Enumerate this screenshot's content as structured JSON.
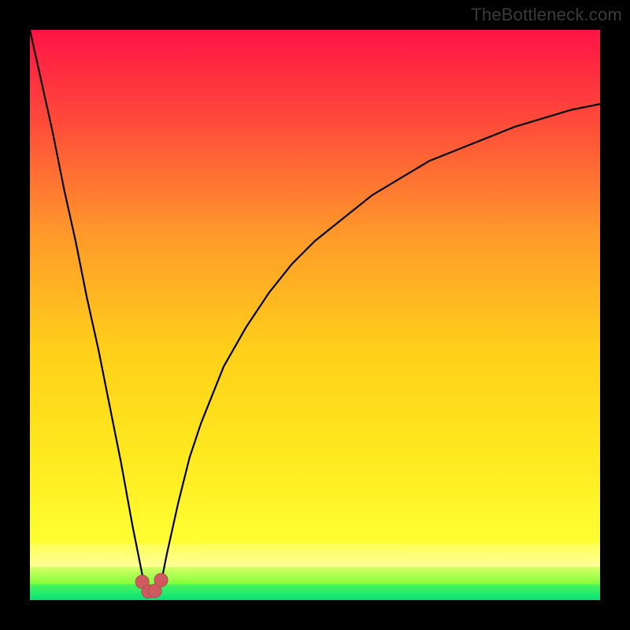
{
  "watermark": "TheBottleneck.com",
  "colors": {
    "frame": "#000000",
    "top": "#ff1a46",
    "upper_mid": "#ff7a26",
    "mid": "#ffd400",
    "low_band": "#ffff6a",
    "green_top": "#7dff3c",
    "green_bottom": "#05e27a",
    "curve": "#000000",
    "marker_fill": "#cf5b60",
    "marker_stroke": "#b24a4f"
  },
  "chart_data": {
    "type": "line",
    "title": "",
    "xlabel": "",
    "ylabel": "",
    "xlim": [
      0,
      100
    ],
    "ylim": [
      0,
      100
    ],
    "x": [
      0,
      2,
      4,
      6,
      8,
      10,
      12,
      14,
      16,
      18,
      19,
      20,
      21,
      22,
      23,
      24,
      26,
      28,
      30,
      34,
      38,
      42,
      46,
      50,
      55,
      60,
      65,
      70,
      75,
      80,
      85,
      90,
      95,
      100
    ],
    "values": [
      100,
      91,
      82,
      72,
      63,
      53,
      44,
      34,
      24,
      13,
      8,
      3,
      1,
      1,
      3,
      8,
      17,
      25,
      31,
      41,
      48,
      54,
      59,
      63,
      67,
      71,
      74,
      77,
      79,
      81,
      83,
      84.5,
      86,
      87
    ],
    "markers": {
      "x": [
        19.7,
        20.8,
        21.9,
        23.0
      ],
      "y": [
        3.2,
        1.5,
        1.6,
        3.5
      ]
    },
    "gradient_bands": [
      {
        "y0": 100,
        "y1": 10,
        "from": "#ff1a46",
        "to": "#ffff33"
      },
      {
        "y0": 10,
        "y1": 6,
        "from": "#ffff6a",
        "to": "#ffff9a"
      },
      {
        "y0": 6,
        "y1": 3,
        "from": "#c8ff55",
        "to": "#7dff3c"
      },
      {
        "y0": 3,
        "y1": 0,
        "from": "#33ef5e",
        "to": "#05e27a"
      }
    ]
  }
}
